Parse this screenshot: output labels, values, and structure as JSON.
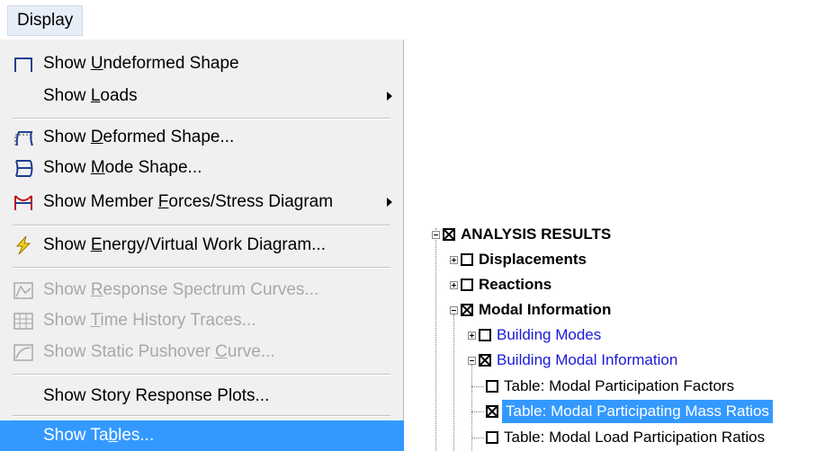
{
  "menu": {
    "title": "Display",
    "items": [
      {
        "prefix": "Show ",
        "mnemonic": "U",
        "suffix": "ndeformed Shape",
        "icon": "undeformed-shape-icon",
        "disabled": false,
        "submenu": false
      },
      {
        "prefix": "Show ",
        "mnemonic": "L",
        "suffix": "oads",
        "icon": "",
        "disabled": false,
        "submenu": true
      },
      {
        "prefix": "Show  ",
        "mnemonic": "D",
        "suffix": "eformed Shape...",
        "icon": "deformed-shape-icon",
        "disabled": false,
        "submenu": false
      },
      {
        "prefix": "Show  ",
        "mnemonic": "M",
        "suffix": "ode Shape...",
        "icon": "mode-shape-icon",
        "disabled": false,
        "submenu": false
      },
      {
        "prefix": "Show Member ",
        "mnemonic": "F",
        "suffix": "orces/Stress Diagram",
        "icon": "member-forces-icon",
        "disabled": false,
        "submenu": true
      },
      {
        "prefix": "Show ",
        "mnemonic": "E",
        "suffix": "nergy/Virtual Work Diagram...",
        "icon": "energy-lightning-icon",
        "disabled": false,
        "submenu": false
      },
      {
        "prefix": "Show ",
        "mnemonic": "R",
        "suffix": "esponse Spectrum Curves...",
        "icon": "response-spectrum-icon",
        "disabled": true,
        "submenu": false
      },
      {
        "prefix": "Show ",
        "mnemonic": "T",
        "suffix": "ime History Traces...",
        "icon": "time-history-icon",
        "disabled": true,
        "submenu": false
      },
      {
        "prefix": "Show Static Pushover ",
        "mnemonic": "C",
        "suffix": "urve...",
        "icon": "pushover-curve-icon",
        "disabled": true,
        "submenu": false
      },
      {
        "prefix": "Show Story Response Plots...",
        "mnemonic": "",
        "suffix": "",
        "icon": "",
        "disabled": false,
        "submenu": false
      },
      {
        "prefix": "Show Ta",
        "mnemonic": "b",
        "suffix": "les...",
        "icon": "",
        "disabled": false,
        "submenu": false,
        "selected": true
      }
    ]
  },
  "tree": {
    "root": {
      "label": "ANALYSIS RESULTS",
      "checked": true,
      "expanded": true
    },
    "displacements": {
      "label": "Displacements",
      "checked": false,
      "expanded": false
    },
    "reactions": {
      "label": "Reactions",
      "checked": false,
      "expanded": false
    },
    "modal_information": {
      "label": "Modal Information",
      "checked": true,
      "expanded": true
    },
    "building_modes": {
      "label": "Building Modes",
      "checked": false,
      "expanded": false
    },
    "building_modal_information": {
      "label": "Building Modal Information",
      "checked": true,
      "expanded": true
    },
    "tables": [
      {
        "label": "Table:  Modal Participation Factors",
        "checked": false,
        "selected": false
      },
      {
        "label": "Table:  Modal Participating Mass Ratios",
        "checked": true,
        "selected": true
      },
      {
        "label": "Table:  Modal Load Participation Ratios",
        "checked": false,
        "selected": false
      }
    ]
  },
  "colors": {
    "selection": "#3399ff",
    "menu_background": "#f0f0f0",
    "disabled_text": "#a8a8a8",
    "tree_link_text": "#1a1ad6"
  }
}
